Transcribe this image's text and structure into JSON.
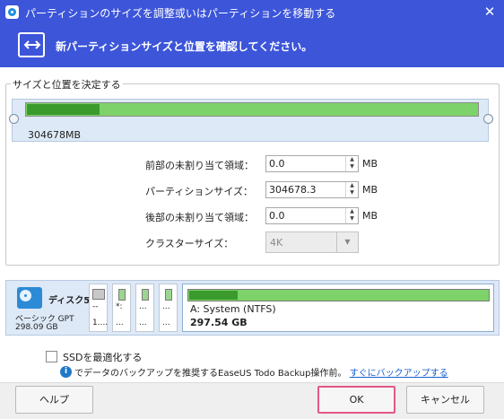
{
  "window": {
    "title": "パーティションのサイズを調整或いはパーティションを移動する",
    "close_glyph": "✕"
  },
  "header": {
    "subtitle": "新パーティションサイズと位置を確認してください。"
  },
  "group": {
    "legend": "サイズと位置を決定する",
    "partition_size": "304678MB",
    "used_fraction": 0.16
  },
  "fields": {
    "unallocated_before": {
      "label": "前部の未割り当て領域：",
      "value": "0.0",
      "unit": "MB"
    },
    "partition_size": {
      "label": "パーティションサイズ：",
      "value": "304678.3",
      "unit": "MB"
    },
    "unallocated_after": {
      "label": "後部の未割り当て領域：",
      "value": "0.0",
      "unit": "MB"
    },
    "cluster_size": {
      "label": "クラスターサイズ：",
      "value": "4K"
    }
  },
  "disk": {
    "name": "ディスク5",
    "type": "ベーシック GPT",
    "size": "298.09 GB",
    "mini_partitions": [
      {
        "line1": "--",
        "line2": "1...."
      },
      {
        "line1": "*:",
        "line2": "..."
      },
      {
        "line1": "...",
        "line2": "..."
      },
      {
        "line1": "...",
        "line2": "..."
      }
    ],
    "selected_partition": {
      "label": "A: System (NTFS)",
      "size": "297.54 GB"
    }
  },
  "options": {
    "ssd_label": "SSDを最適化する",
    "ssd_checked": false,
    "info_glyph": "i",
    "info_text": "でデータのバックアップを推奨するEaseUS Todo Backup操作前。",
    "info_link": "すぐにバックアップする"
  },
  "buttons": {
    "help": "ヘルプ",
    "ok": "OK",
    "cancel": "キャンセル"
  },
  "colors": {
    "accent": "#3c55d9",
    "partition_free": "#7dd36a",
    "partition_used": "#3a9b2c",
    "ok_focus": "#e2578a"
  }
}
